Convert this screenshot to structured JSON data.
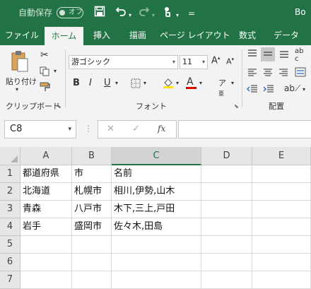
{
  "titlebar": {
    "autosave_label": "自動保存",
    "autosave_state": "オフ",
    "title_fragment": "Bo"
  },
  "tabs": [
    "ファイル",
    "ホーム",
    "挿入",
    "描画",
    "ページ レイアウト",
    "数式",
    "データ"
  ],
  "ribbon": {
    "clipboard": {
      "paste_label": "貼り付け",
      "group_label": "クリップボード"
    },
    "font": {
      "font_name": "游ゴシック",
      "font_size": "11",
      "group_label": "フォント",
      "bold": "B",
      "italic": "I",
      "underline": "U"
    },
    "alignment": {
      "group_label": "配置"
    }
  },
  "formula_bar": {
    "name_box": "C8",
    "cancel": "✕",
    "enter": "✓",
    "fx": "fx",
    "formula": ""
  },
  "sheet": {
    "columns": [
      "A",
      "B",
      "C",
      "D",
      "E"
    ],
    "rows": [
      "1",
      "2",
      "3",
      "4",
      "5",
      "6",
      "7"
    ],
    "cells": [
      [
        "都道府県",
        "市",
        "名前",
        "",
        ""
      ],
      [
        "北海道",
        "札幌市",
        "相川,伊勢,山木",
        "",
        ""
      ],
      [
        "青森",
        "八戸市",
        "木下,三上,戸田",
        "",
        ""
      ],
      [
        "岩手",
        "盛岡市",
        "佐々木,田島",
        "",
        ""
      ],
      [
        "",
        "",
        "",
        "",
        ""
      ],
      [
        "",
        "",
        "",
        "",
        ""
      ],
      [
        "",
        "",
        "",
        "",
        ""
      ]
    ]
  },
  "colors": {
    "accent": "#217346",
    "ribbon_bg": "#f3f3f3",
    "header_bg": "#e6e6e6"
  }
}
